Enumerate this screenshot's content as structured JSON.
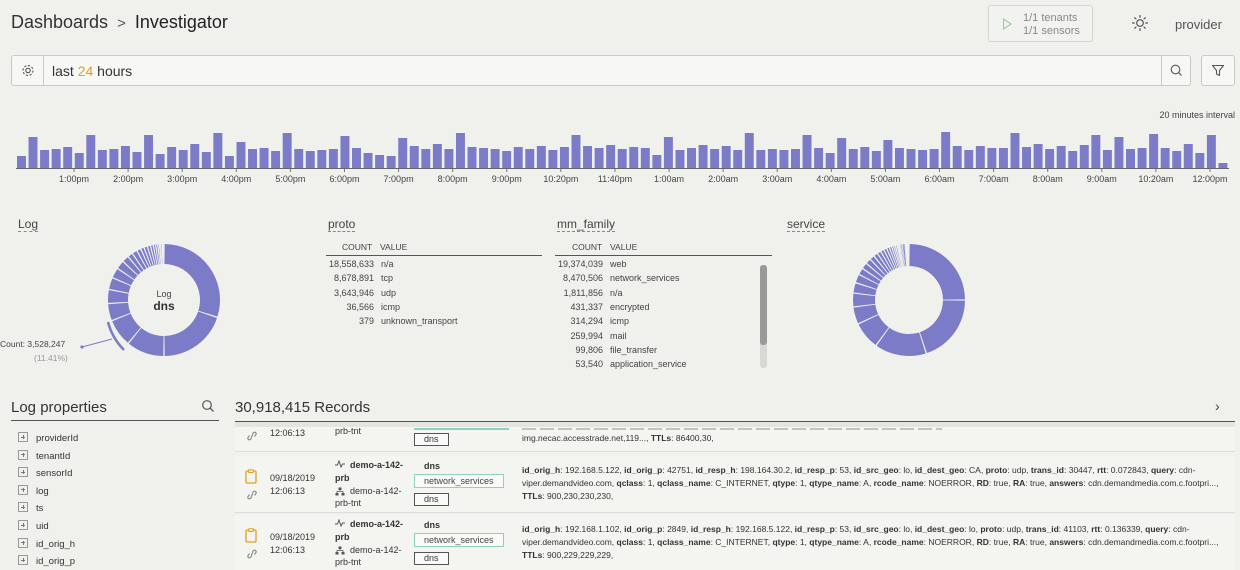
{
  "header": {
    "breadcrumb_root": "Dashboards",
    "breadcrumb_sep": ">",
    "breadcrumb_current": "Investigator",
    "tenants_line1": "1/1 tenants",
    "tenants_line2": "1/1 sensors",
    "user": "provider"
  },
  "search": {
    "prefix": "last",
    "number": "24",
    "suffix": "hours"
  },
  "histogram": {
    "interval_label": "20 minutes interval",
    "bar_color": "#7b7bc8",
    "values": [
      12,
      31,
      18,
      19,
      21,
      15,
      33,
      18,
      19,
      22,
      16,
      33,
      14,
      21,
      18,
      24,
      16,
      35,
      12,
      26,
      19,
      20,
      17,
      35,
      19,
      17,
      18,
      19,
      32,
      20,
      15,
      13,
      12,
      30,
      22,
      19,
      24,
      19,
      35,
      21,
      20,
      19,
      17,
      21,
      19,
      22,
      18,
      21,
      33,
      22,
      20,
      23,
      19,
      21,
      20,
      13,
      31,
      18,
      20,
      23,
      19,
      22,
      18,
      35,
      18,
      19,
      18,
      19,
      33,
      20,
      15,
      30,
      19,
      21,
      17,
      28,
      20,
      19,
      18,
      19,
      36,
      22,
      18,
      22,
      20,
      20,
      35,
      21,
      24,
      19,
      22,
      17,
      23,
      33,
      18,
      31,
      19,
      20,
      34,
      20,
      17,
      24,
      15,
      33,
      5
    ],
    "ticks": [
      "1:00pm",
      "2:00pm",
      "3:00pm",
      "4:00pm",
      "5:00pm",
      "6:00pm",
      "7:00pm",
      "8:00pm",
      "9:00pm",
      "10:20pm",
      "11:40pm",
      "1:00am",
      "2:00am",
      "3:00am",
      "4:00am",
      "5:00am",
      "6:00am",
      "7:00am",
      "8:00am",
      "9:00am",
      "10:20am",
      "12:00pm"
    ]
  },
  "log_widget": {
    "title": "Log",
    "center_label": "Log",
    "center_value": "dns",
    "callout_count": "Count: 3,528,247",
    "callout_pct": "(11.41%)",
    "color": "#7b7bc8"
  },
  "proto_widget": {
    "title": "proto",
    "col_count": "COUNT",
    "col_value": "VALUE",
    "rows": [
      {
        "count": "18,558,633",
        "value": "n/a"
      },
      {
        "count": "8,678,891",
        "value": "tcp"
      },
      {
        "count": "3,643,946",
        "value": "udp"
      },
      {
        "count": "36,566",
        "value": "icmp"
      },
      {
        "count": "379",
        "value": "unknown_transport"
      }
    ]
  },
  "mm_family_widget": {
    "title": "mm_family",
    "col_count": "COUNT",
    "col_value": "VALUE",
    "rows": [
      {
        "count": "19,374,039",
        "value": "web"
      },
      {
        "count": "8,470,506",
        "value": "network_services"
      },
      {
        "count": "1,811,856",
        "value": "n/a"
      },
      {
        "count": "431,337",
        "value": "encrypted"
      },
      {
        "count": "314,294",
        "value": "icmp"
      },
      {
        "count": "259,994",
        "value": "mail"
      },
      {
        "count": "99,806",
        "value": "file_transfer"
      },
      {
        "count": "53,540",
        "value": "application_service"
      }
    ]
  },
  "service_widget": {
    "title": "service"
  },
  "log_properties": {
    "title": "Log properties",
    "items": [
      "providerId",
      "tenantId",
      "sensorId",
      "log",
      "ts",
      "uid",
      "id_orig_h",
      "id_orig_p"
    ]
  },
  "records": {
    "title": "30,918,415 Records",
    "partial": {
      "time": "12:06:13",
      "sensor": "prb-tnt",
      "tag": "dns",
      "detail_line": "img.necac.accesstrade.net,119...,",
      "ttls_key": "TTLs",
      "ttls_val": ": 86400,30,"
    },
    "items": [
      {
        "date": "09/18/2019",
        "time": "12:06:13",
        "host_line1": "demo-a-142-",
        "host_line2": "prb",
        "sensor_line1": "demo-a-142-",
        "sensor_line2": "prb-tnt",
        "log": "dns",
        "family": "network_services",
        "service": "dns",
        "pairs": [
          [
            "id_orig_h",
            "192.168.5.122"
          ],
          [
            "id_orig_p",
            "42751"
          ],
          [
            "id_resp_h",
            "198.164.30.2"
          ],
          [
            "id_resp_p",
            "53"
          ],
          [
            "id_src_geo",
            "lo"
          ],
          [
            "id_dest_geo",
            "CA"
          ],
          [
            "proto",
            "udp"
          ],
          [
            "trans_id",
            "30447"
          ],
          [
            "rtt",
            "0.072843"
          ],
          [
            "query",
            "cdn-viper.demandvideo.com"
          ],
          [
            "qclass",
            "1"
          ],
          [
            "qclass_name",
            "C_INTERNET"
          ],
          [
            "qtype",
            "1"
          ],
          [
            "qtype_name",
            "A"
          ],
          [
            "rcode_name",
            "NOERROR"
          ],
          [
            "RD",
            "true"
          ],
          [
            "RA",
            "true"
          ],
          [
            "answers",
            "cdn.demandmedia.com.c.footpri..."
          ],
          [
            "TTLs",
            "900,230,230,230"
          ]
        ]
      },
      {
        "date": "09/18/2019",
        "time": "12:06:13",
        "host_line1": "demo-a-142-",
        "host_line2": "prb",
        "sensor_line1": "demo-a-142-",
        "sensor_line2": "prb-tnt",
        "log": "dns",
        "family": "network_services",
        "service": "dns",
        "pairs": [
          [
            "id_orig_h",
            "192.168.1.102"
          ],
          [
            "id_orig_p",
            "2849"
          ],
          [
            "id_resp_h",
            "192.168.5.122"
          ],
          [
            "id_resp_p",
            "53"
          ],
          [
            "id_src_geo",
            "lo"
          ],
          [
            "id_dest_geo",
            "lo"
          ],
          [
            "proto",
            "udp"
          ],
          [
            "trans_id",
            "41103"
          ],
          [
            "rtt",
            "0.136339"
          ],
          [
            "query",
            "cdn-viper.demandvideo.com"
          ],
          [
            "qclass",
            "1"
          ],
          [
            "qclass_name",
            "C_INTERNET"
          ],
          [
            "qtype",
            "1"
          ],
          [
            "qtype_name",
            "A"
          ],
          [
            "rcode_name",
            "NOERROR"
          ],
          [
            "RD",
            "true"
          ],
          [
            "RA",
            "true"
          ],
          [
            "answers",
            "cdn.demandmedia.com.c.footpri..."
          ],
          [
            "TTLs",
            "900,229,229,229"
          ]
        ]
      }
    ]
  }
}
